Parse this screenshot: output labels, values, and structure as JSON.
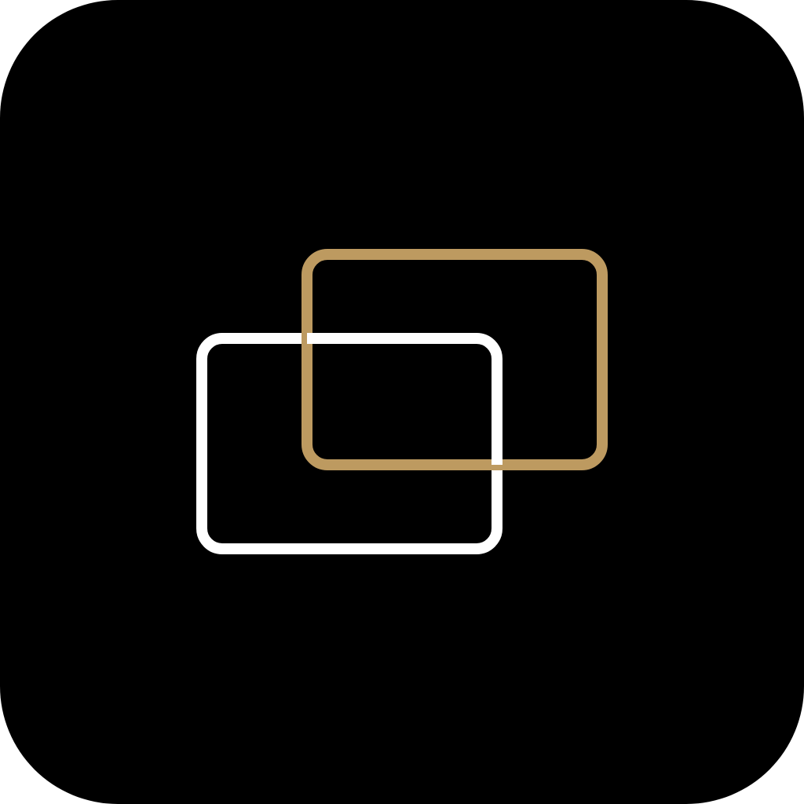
{
  "icon": {
    "name": "overlapping-cards",
    "background_color": "#000000",
    "front_card_color": "#ffffff",
    "back_card_color": "#bd9a60"
  }
}
